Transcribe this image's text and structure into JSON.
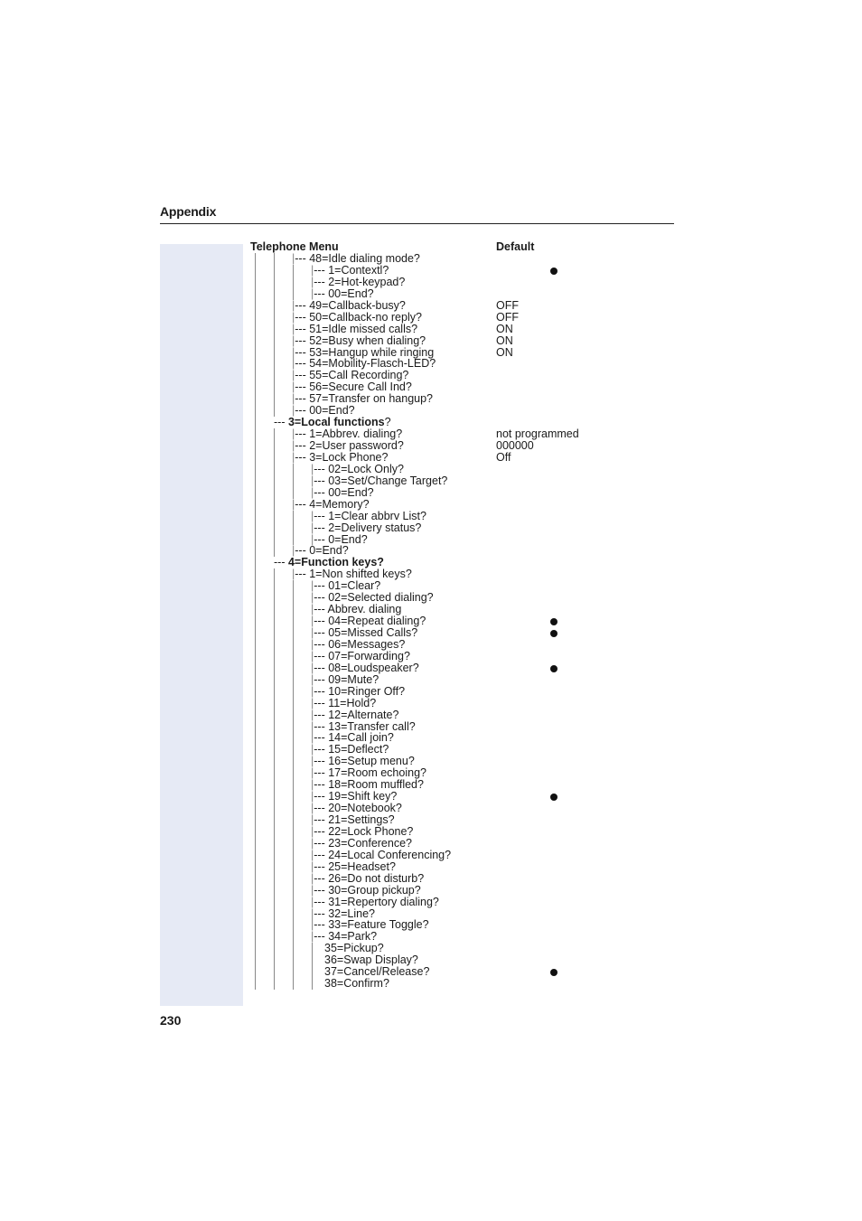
{
  "header": {
    "title": "Appendix"
  },
  "page_number": "230",
  "table": {
    "col_menu": "Telephone Menu",
    "col_default": "Default",
    "rows": [
      {
        "d": 3,
        "t": "|--- 48=Idle dialing mode?"
      },
      {
        "d": 4,
        "t": "|--- 1=Contextl?",
        "dot": true
      },
      {
        "d": 4,
        "t": "|--- 2=Hot-keypad?"
      },
      {
        "d": 4,
        "t": "|--- 00=End?"
      },
      {
        "d": 3,
        "t": "|--- 49=Callback-busy?",
        "v": "OFF"
      },
      {
        "d": 3,
        "t": "|--- 50=Callback-no reply?",
        "v": "OFF"
      },
      {
        "d": 3,
        "t": "|--- 51=Idle missed calls?",
        "v": "ON"
      },
      {
        "d": 3,
        "t": "|--- 52=Busy when dialing?",
        "v": "ON"
      },
      {
        "d": 3,
        "t": "|--- 53=Hangup while ringing",
        "v": "ON"
      },
      {
        "d": 3,
        "t": "|--- 54=Mobility-Flasch-LED?"
      },
      {
        "d": 3,
        "t": "|--- 55=Call Recording?"
      },
      {
        "d": 3,
        "t": "|--- 56=Secure Call Ind?"
      },
      {
        "d": 3,
        "t": "|--- 57=Transfer on hangup?"
      },
      {
        "d": 3,
        "t": "|--- 00=End?"
      },
      {
        "d": 2,
        "t": "--- ",
        "b": "3=Local functions",
        "s": "?"
      },
      {
        "d": 3,
        "t": "|--- 1=Abbrev. dialing?",
        "v": "not programmed"
      },
      {
        "d": 3,
        "t": "|--- 2=User password?",
        "v": "000000"
      },
      {
        "d": 3,
        "t": "|--- 3=Lock Phone?",
        "v": "Off"
      },
      {
        "d": 4,
        "t": "|--- 02=Lock Only?"
      },
      {
        "d": 4,
        "t": "|--- 03=Set/Change Target?"
      },
      {
        "d": 4,
        "t": "|--- 00=End?"
      },
      {
        "d": 3,
        "t": "|--- 4=Memory?"
      },
      {
        "d": 4,
        "t": "|--- 1=Clear abbrv List?"
      },
      {
        "d": 4,
        "t": "|--- 2=Delivery status?"
      },
      {
        "d": 4,
        "t": "|--- 0=End?"
      },
      {
        "d": 3,
        "t": "|--- 0=End?"
      },
      {
        "d": 2,
        "t": "--- ",
        "b": "4=Function keys?"
      },
      {
        "d": 3,
        "t": "|--- 1=Non shifted keys?"
      },
      {
        "d": 4,
        "t": "|--- 01=Clear?"
      },
      {
        "d": 4,
        "t": "|--- 02=Selected dialing?"
      },
      {
        "d": 4,
        "t": "|--- Abbrev. dialing"
      },
      {
        "d": 4,
        "t": "|--- 04=Repeat dialing?",
        "dot": true
      },
      {
        "d": 4,
        "t": "|--- 05=Missed Calls?",
        "dot": true
      },
      {
        "d": 4,
        "t": "|--- 06=Messages?"
      },
      {
        "d": 4,
        "t": "|--- 07=Forwarding?"
      },
      {
        "d": 4,
        "t": "|--- 08=Loudspeaker?",
        "dot": true
      },
      {
        "d": 4,
        "t": "|--- 09=Mute?"
      },
      {
        "d": 4,
        "t": "|--- 10=Ringer Off?"
      },
      {
        "d": 4,
        "t": "|--- 11=Hold?"
      },
      {
        "d": 4,
        "t": "|--- 12=Alternate?"
      },
      {
        "d": 4,
        "t": "|--- 13=Transfer call?"
      },
      {
        "d": 4,
        "t": "|--- 14=Call join?"
      },
      {
        "d": 4,
        "t": "|--- 15=Deflect?"
      },
      {
        "d": 4,
        "t": "|--- 16=Setup menu?"
      },
      {
        "d": 4,
        "t": "|--- 17=Room echoing?"
      },
      {
        "d": 4,
        "t": "|--- 18=Room muffled?"
      },
      {
        "d": 4,
        "t": "|--- 19=Shift key?",
        "dot": true
      },
      {
        "d": 4,
        "t": "|--- 20=Notebook?"
      },
      {
        "d": 4,
        "t": "|--- 21=Settings?"
      },
      {
        "d": 4,
        "t": "|--- 22=Lock Phone?"
      },
      {
        "d": 4,
        "t": "|--- 23=Conference?"
      },
      {
        "d": 4,
        "t": "|--- 24=Local Conferencing?"
      },
      {
        "d": 4,
        "t": "|--- 25=Headset?"
      },
      {
        "d": 4,
        "t": "|--- 26=Do not disturb?"
      },
      {
        "d": 4,
        "t": "|--- 30=Group pickup?"
      },
      {
        "d": 4,
        "t": "|--- 31=Repertory dialing?"
      },
      {
        "d": 4,
        "t": "|--- 32=Line?"
      },
      {
        "d": 4,
        "t": "|--- 33=Feature Toggle?"
      },
      {
        "d": 4,
        "t": "|--- 34=Park?"
      },
      {
        "d": 4,
        "t": "35=Pickup?",
        "plain": true
      },
      {
        "d": 4,
        "t": "36=Swap Display?",
        "plain": true
      },
      {
        "d": 4,
        "t": "37=Cancel/Release?",
        "plain": true,
        "dot": true
      },
      {
        "d": 4,
        "t": "38=Confirm?",
        "plain": true
      }
    ]
  }
}
